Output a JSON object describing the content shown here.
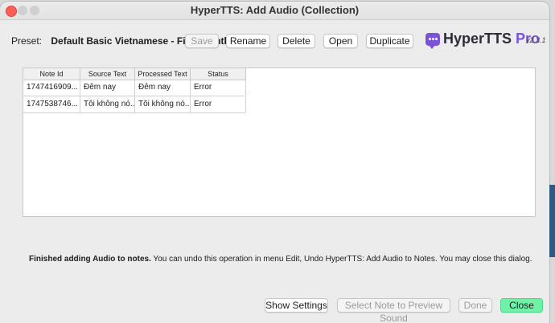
{
  "window": {
    "title": "HyperTTS: Add Audio (Collection)"
  },
  "preset": {
    "label": "Preset:",
    "name": "Default Basic Vietnamese - First month"
  },
  "toolbar": {
    "save_label": "Save",
    "rename_label": "Rename",
    "delete_label": "Delete",
    "open_label": "Open",
    "duplicate_label": "Duplicate"
  },
  "logo": {
    "text": "HyperTTS",
    "pro": "Pro",
    "version": "v2.3.1"
  },
  "table": {
    "headers": [
      "Note Id",
      "Source Text",
      "Processed Text",
      "Status"
    ],
    "rows": [
      [
        "1747416909...",
        "Đêm nay",
        "Đêm nay",
        "Error"
      ],
      [
        "1747538746...",
        "Tôi không nó...",
        "Tôi không nó...",
        "Error"
      ]
    ]
  },
  "status": {
    "bold": "Finished adding Audio to notes.",
    "rest": " You can undo this operation in menu Edit, Undo HyperTTS: Add Audio to Notes. You may close this dialog."
  },
  "footer": {
    "show_settings_label": "Show Settings",
    "preview_label": "Select Note to Preview Sound",
    "done_label": "Done",
    "close_label": "Close"
  },
  "colors": {
    "accent": "#6ff2a8",
    "brand": "#7b53d8",
    "close_light": "#fe5f57"
  }
}
